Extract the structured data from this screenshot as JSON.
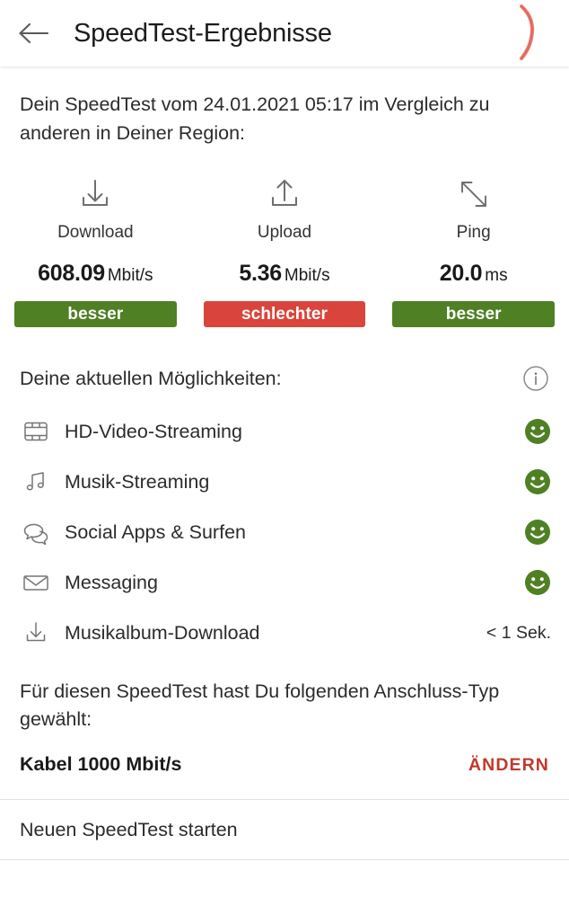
{
  "header": {
    "back_icon": "arrow-left-icon",
    "title": "SpeedTest-Ergebnisse",
    "annotation": "red-handdrawn-stroke"
  },
  "intro": {
    "text": "Dein SpeedTest vom 24.01.2021 05:17 im Vergleich zu anderen in Deiner Region:"
  },
  "metrics": [
    {
      "icon": "download-icon",
      "label": "Download",
      "value": "608.09",
      "unit": "Mbit/s",
      "badge_label": "besser",
      "badge_color": "#4F8024"
    },
    {
      "icon": "upload-icon",
      "label": "Upload",
      "value": "5.36",
      "unit": "Mbit/s",
      "badge_label": "schlechter",
      "badge_color": "#D9453C"
    },
    {
      "icon": "ping-arrows-icon",
      "label": "Ping",
      "value": "20.0",
      "unit": "ms",
      "badge_label": "besser",
      "badge_color": "#4F8024"
    }
  ],
  "capabilities": {
    "title": "Deine aktuellen Möglichkeiten:",
    "info_icon": "info-circle-icon",
    "smiley_color": "#4F8024",
    "items": [
      {
        "icon": "film-strip-icon",
        "label": "HD-Video-Streaming",
        "status_type": "smiley",
        "status_text": ""
      },
      {
        "icon": "music-note-icon",
        "label": "Musik-Streaming",
        "status_type": "smiley",
        "status_text": ""
      },
      {
        "icon": "chat-bubbles-icon",
        "label": "Social Apps & Surfen",
        "status_type": "smiley",
        "status_text": ""
      },
      {
        "icon": "envelope-icon",
        "label": "Messaging",
        "status_type": "smiley",
        "status_text": ""
      },
      {
        "icon": "download-icon",
        "label": "Musikalbum-Download",
        "status_type": "text",
        "status_text": "< 1 Sek."
      }
    ]
  },
  "connection": {
    "description": "Für diesen SpeedTest hast Du folgenden Anschluss-Typ gewählt:",
    "value": "Kabel 1000 Mbit/s",
    "change_label": "ÄNDERN",
    "change_color": "#C0392B"
  },
  "bottom_action": {
    "label": "Neuen SpeedTest starten"
  }
}
